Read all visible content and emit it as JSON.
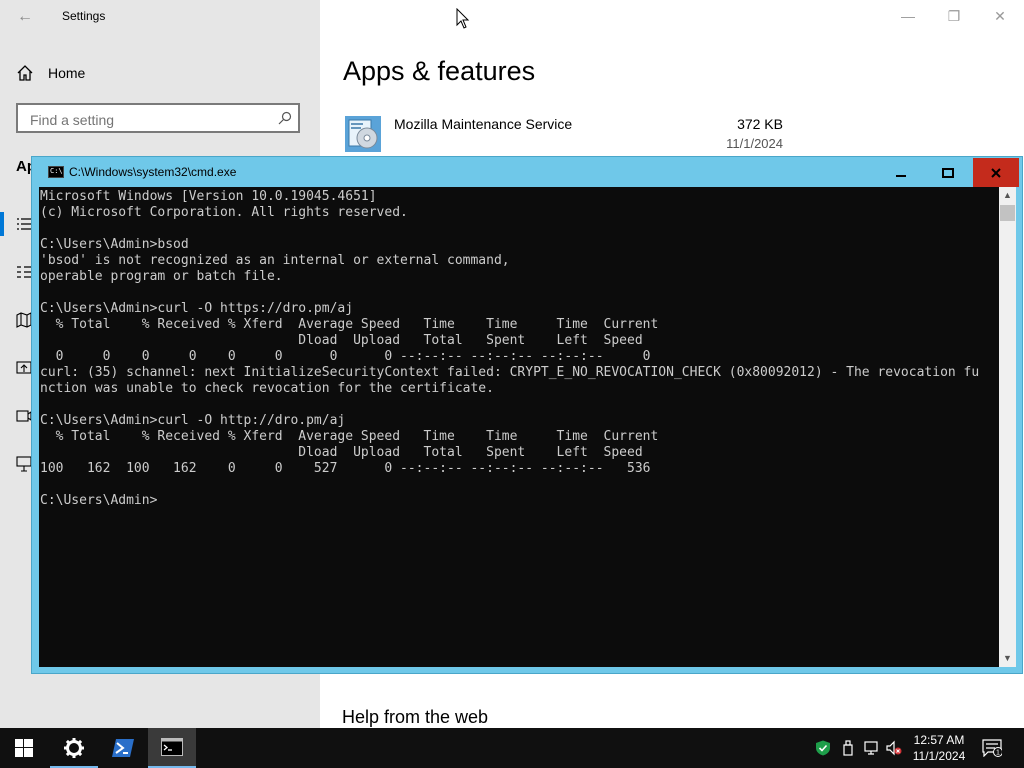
{
  "settings": {
    "title": "Settings",
    "home_label": "Home",
    "search_placeholder": "Find a setting",
    "section_label": "Ap",
    "page_title": "Apps & features",
    "app": {
      "name": "Mozilla Maintenance Service",
      "size": "372 KB",
      "date": "11/1/2024"
    },
    "help_title": "Help from the web"
  },
  "cmd": {
    "title": "C:\\Windows\\system32\\cmd.exe",
    "output": "Microsoft Windows [Version 10.0.19045.4651]\n(c) Microsoft Corporation. All rights reserved.\n\nC:\\Users\\Admin>bsod\n'bsod' is not recognized as an internal or external command,\noperable program or batch file.\n\nC:\\Users\\Admin>curl -O https://dro.pm/aj\n  % Total    % Received % Xferd  Average Speed   Time    Time     Time  Current\n                                 Dload  Upload   Total   Spent    Left  Speed\n  0     0    0     0    0     0      0      0 --:--:-- --:--:-- --:--:--     0\ncurl: (35) schannel: next InitializeSecurityContext failed: CRYPT_E_NO_REVOCATION_CHECK (0x80092012) - The revocation fu\nnction was unable to check revocation for the certificate.\n\nC:\\Users\\Admin>curl -O http://dro.pm/aj\n  % Total    % Received % Xferd  Average Speed   Time    Time     Time  Current\n                                 Dload  Upload   Total   Spent    Left  Speed\n100   162  100   162    0     0    527      0 --:--:-- --:--:-- --:--:--   536\n\nC:\\Users\\Admin>"
  },
  "taskbar": {
    "items": [
      "start-button",
      "settings-app",
      "powershell-app",
      "cmd-app"
    ],
    "clock_time": "12:57 AM",
    "clock_date": "11/1/2024",
    "notification_count": "1"
  },
  "colors": {
    "cmd_title_bg": "#6fc8e9",
    "cmd_close": "#c42b1c",
    "accent": "#0078d7"
  }
}
